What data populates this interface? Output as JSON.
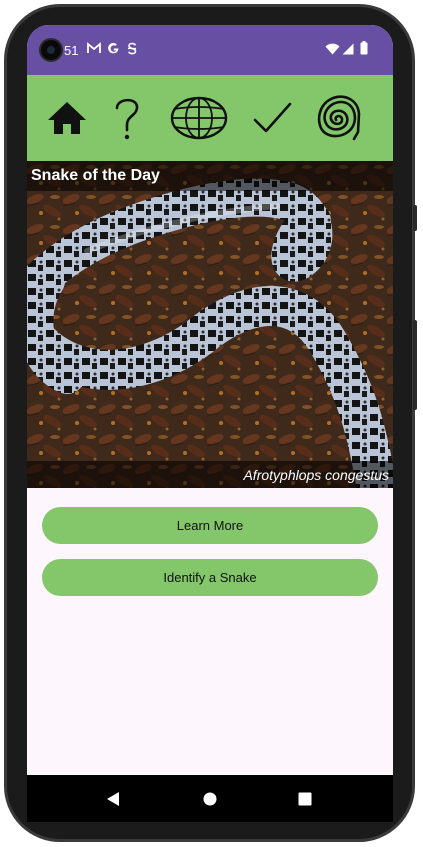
{
  "status": {
    "time": "51",
    "icons": [
      "gmail-icon",
      "google-icon",
      "s-icon",
      "wifi-icon",
      "signal-icon",
      "battery-icon"
    ]
  },
  "nav": {
    "items": [
      {
        "name": "home-icon"
      },
      {
        "name": "question-icon"
      },
      {
        "name": "globe-icon"
      },
      {
        "name": "check-icon"
      },
      {
        "name": "spiral-icon"
      }
    ],
    "bg": "#83c76a"
  },
  "hero": {
    "title": "Snake of the Day",
    "caption": "Afrotyphlops congestus"
  },
  "buttons": {
    "learn_more": "Learn More",
    "identify": "Identify a Snake"
  },
  "colors": {
    "statusbar": "#6750a4",
    "accent": "#83c76a",
    "background": "#fdf6fc"
  }
}
